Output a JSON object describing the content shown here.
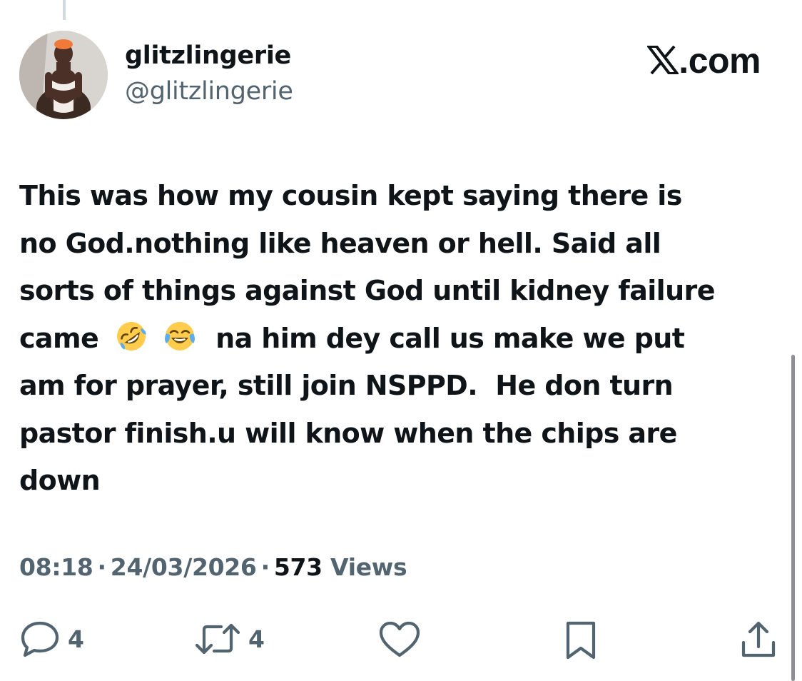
{
  "author": {
    "display_name": "glitzlingerie",
    "handle": "@glitzlingerie"
  },
  "brand": {
    "label": ".com",
    "icon": "x-logo-icon"
  },
  "tweet": {
    "lines": [
      "This was how my cousin kept saying there is",
      "no God.nothing like heaven or hell. Said all",
      "sorts of things against God until kidney failure"
    ],
    "line4_before": "came",
    "emoji_1": "rolling-on-floor-laughing",
    "emoji_2": "face-with-tears-of-joy",
    "line4_after": "na him dey call us make we put",
    "lines_after": [
      "am for prayer, still join NSPPD.  He don turn",
      "pastor finish.u will know when the chips are",
      "down"
    ]
  },
  "meta": {
    "time": "08:18",
    "date": "24/03/2026",
    "views_count": "573",
    "views_label": "Views",
    "separator": "·"
  },
  "actions": {
    "reply_count": "4",
    "retweet_count": "4"
  },
  "colors": {
    "text": "#0f1419",
    "secondary": "#536471",
    "emoji_yellow": "#ffcc4d"
  }
}
